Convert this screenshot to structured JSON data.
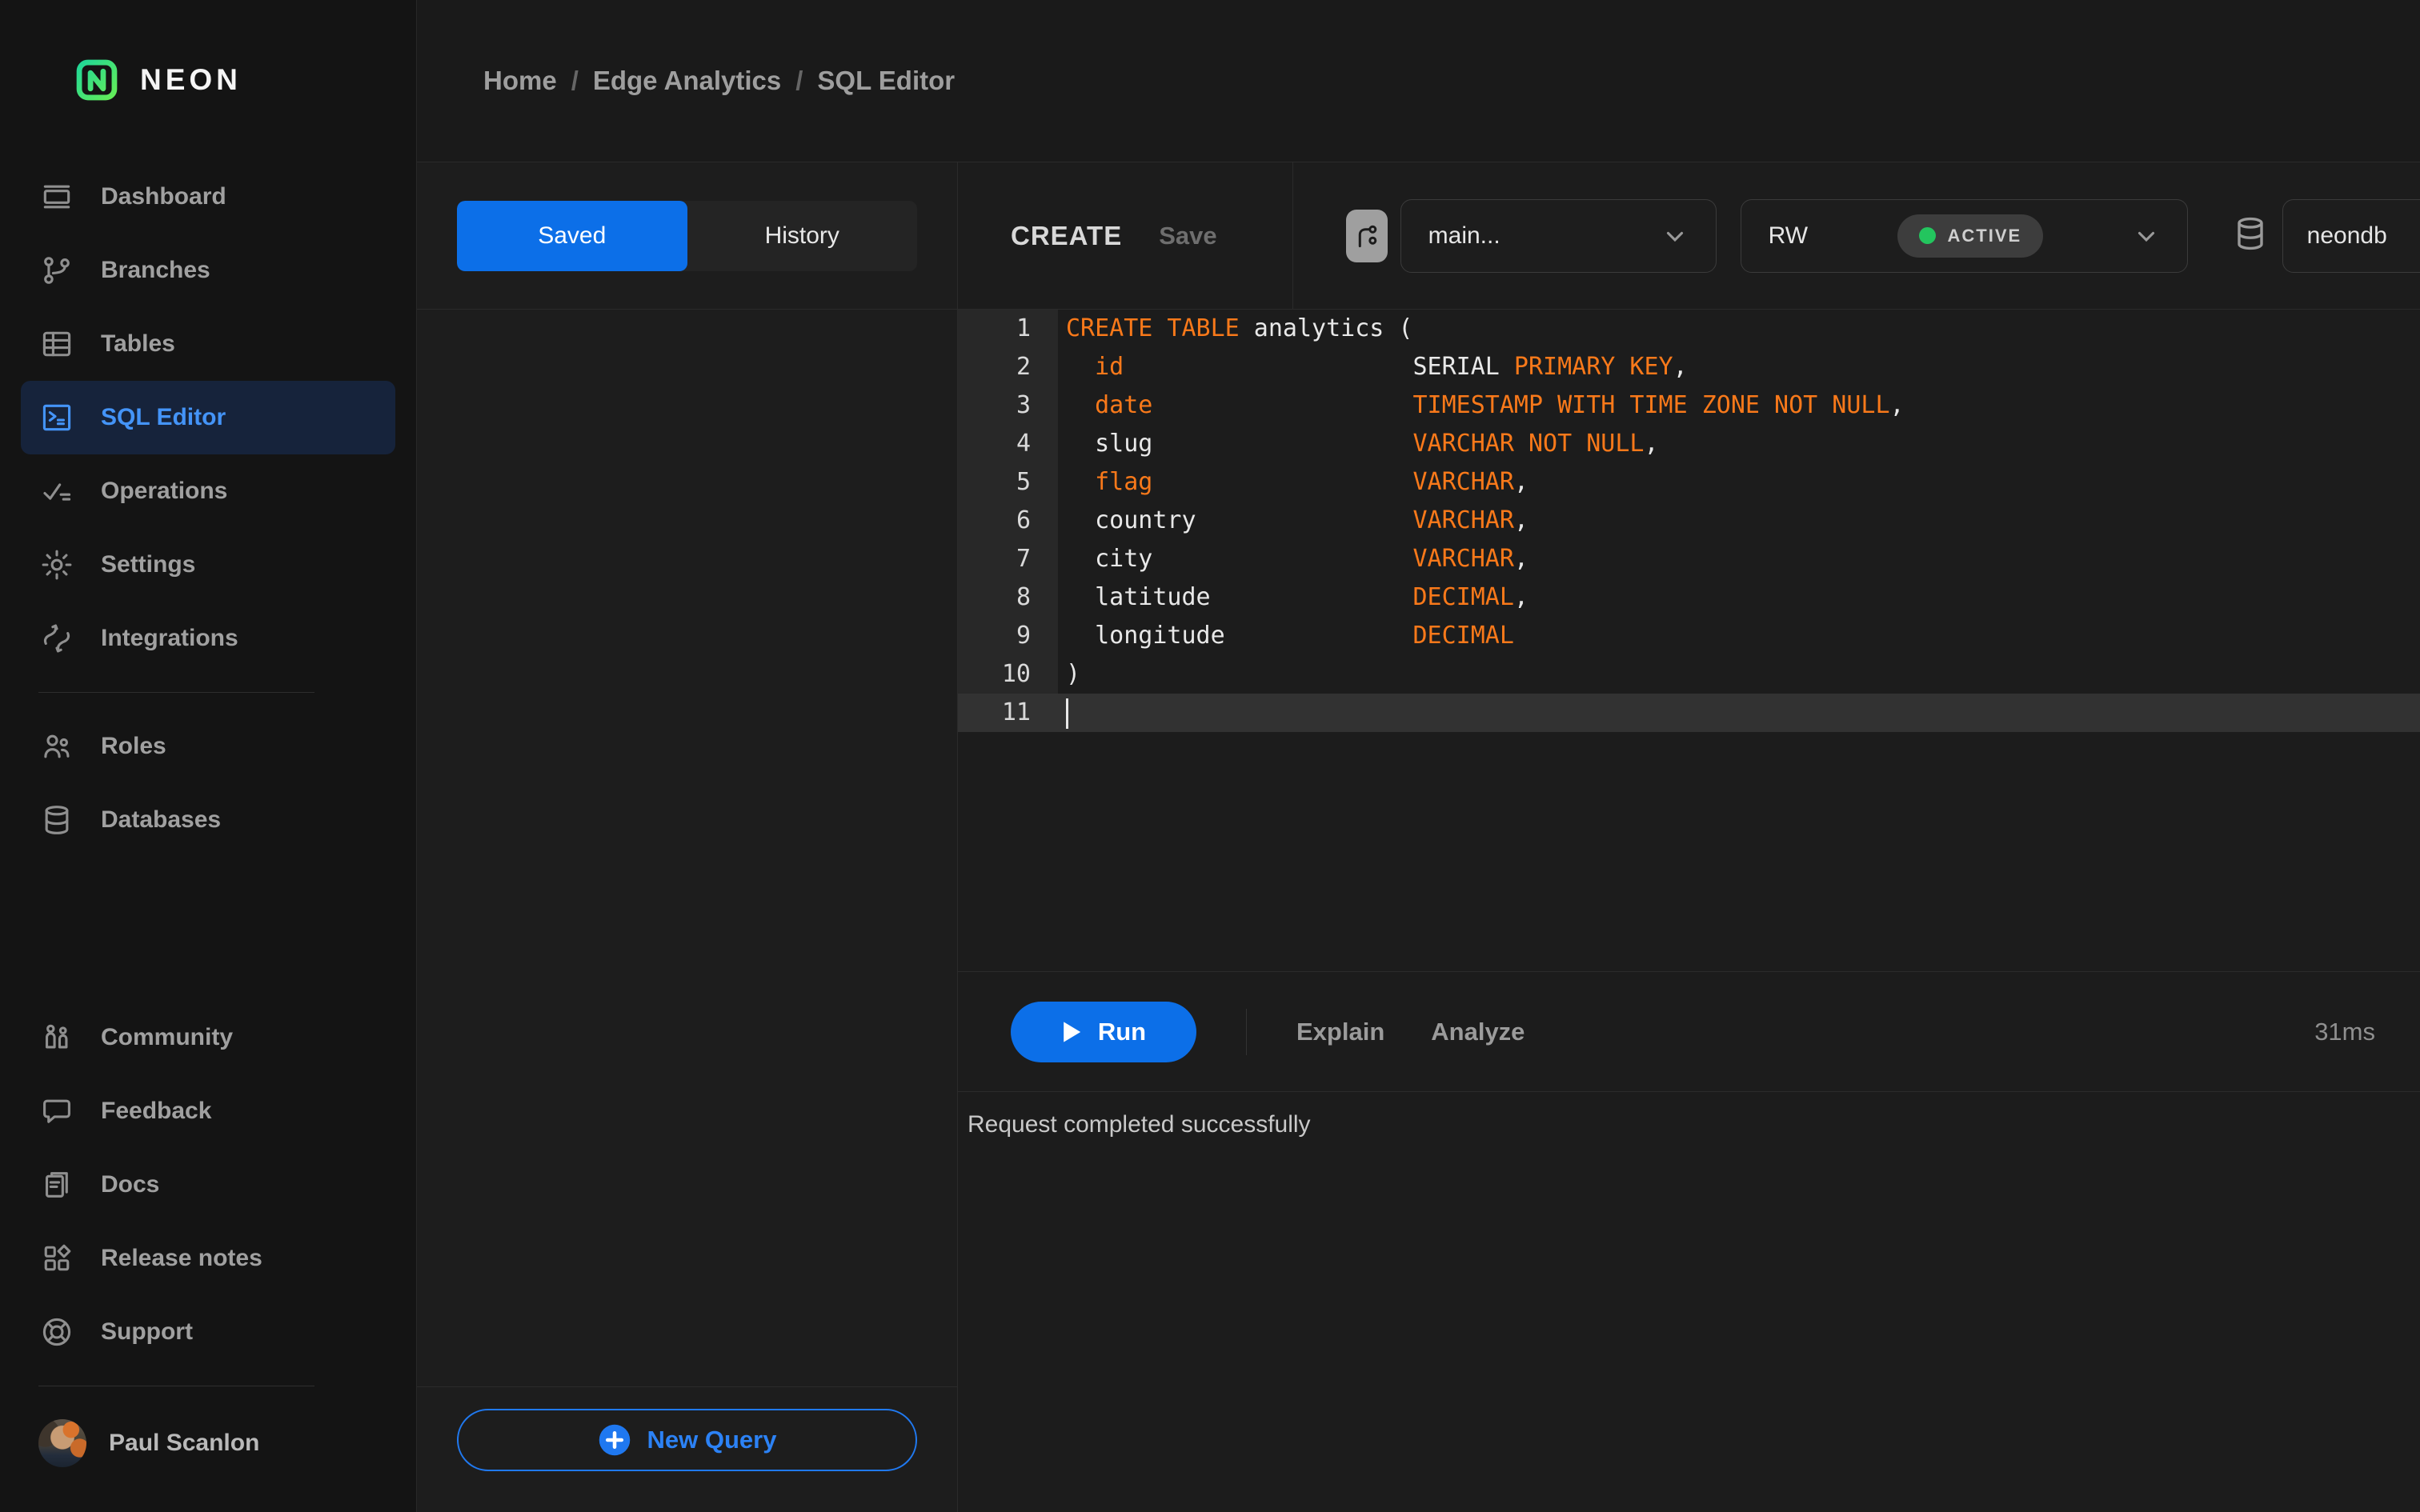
{
  "colors": {
    "accent_blue": "#0c6fe8",
    "outline_blue": "#2079f0",
    "active_nav_text": "#4494f8",
    "active_nav_bg": "#16233b",
    "keyword_orange": "#f9791a",
    "status_green": "#23c55e",
    "logo_gradient_start": "#16d4a1",
    "logo_gradient_end": "#6ef04e"
  },
  "sidebar": {
    "logo_text": "NEON",
    "groups": [
      [
        {
          "label": "Dashboard",
          "icon": "dashboard-icon"
        },
        {
          "label": "Branches",
          "icon": "branches-icon"
        },
        {
          "label": "Tables",
          "icon": "tables-icon"
        },
        {
          "label": "SQL Editor",
          "icon": "sql-editor-icon",
          "active": true
        },
        {
          "label": "Operations",
          "icon": "operations-icon"
        },
        {
          "label": "Settings",
          "icon": "settings-icon"
        },
        {
          "label": "Integrations",
          "icon": "integrations-icon"
        }
      ],
      [
        {
          "label": "Roles",
          "icon": "roles-icon"
        },
        {
          "label": "Databases",
          "icon": "databases-icon"
        }
      ],
      [
        {
          "label": "Community",
          "icon": "community-icon"
        },
        {
          "label": "Feedback",
          "icon": "feedback-icon"
        },
        {
          "label": "Docs",
          "icon": "docs-icon"
        },
        {
          "label": "Release notes",
          "icon": "release-notes-icon"
        },
        {
          "label": "Support",
          "icon": "support-icon"
        }
      ]
    ],
    "user": {
      "name": "Paul Scanlon"
    }
  },
  "breadcrumb": {
    "items": [
      "Home",
      "Edge Analytics",
      "SQL Editor"
    ],
    "separator": "/"
  },
  "left_panel": {
    "tabs": [
      {
        "label": "Saved",
        "active": true
      },
      {
        "label": "History",
        "active": false
      }
    ],
    "new_query_label": "New Query"
  },
  "editor": {
    "query_name": "CREATE",
    "save_label": "Save",
    "branch_select": {
      "value": "main..."
    },
    "compute_select": {
      "value": "RW",
      "status": "ACTIVE"
    },
    "database_select": {
      "value": "neondb"
    },
    "code_lines": [
      {
        "n": "1",
        "toks": [
          [
            "CREATE TABLE",
            "k"
          ],
          [
            " analytics (",
            "p"
          ]
        ]
      },
      {
        "n": "2",
        "toks": [
          [
            "  ",
            "p"
          ],
          [
            "id",
            "k"
          ],
          [
            "                    SERIAL ",
            "p"
          ],
          [
            "PRIMARY KEY",
            "k"
          ],
          [
            ",",
            "p"
          ]
        ]
      },
      {
        "n": "3",
        "toks": [
          [
            "  ",
            "p"
          ],
          [
            "date",
            "k"
          ],
          [
            "                  ",
            "p"
          ],
          [
            "TIMESTAMP WITH TIME ZONE NOT NULL",
            "k"
          ],
          [
            ",",
            "p"
          ]
        ]
      },
      {
        "n": "4",
        "toks": [
          [
            "  slug                  ",
            "p"
          ],
          [
            "VARCHAR NOT NULL",
            "k"
          ],
          [
            ",",
            "p"
          ]
        ]
      },
      {
        "n": "5",
        "toks": [
          [
            "  ",
            "p"
          ],
          [
            "flag",
            "k"
          ],
          [
            "                  ",
            "p"
          ],
          [
            "VARCHAR",
            "k"
          ],
          [
            ",",
            "p"
          ]
        ]
      },
      {
        "n": "6",
        "toks": [
          [
            "  country               ",
            "p"
          ],
          [
            "VARCHAR",
            "k"
          ],
          [
            ",",
            "p"
          ]
        ]
      },
      {
        "n": "7",
        "toks": [
          [
            "  city                  ",
            "p"
          ],
          [
            "VARCHAR",
            "k"
          ],
          [
            ",",
            "p"
          ]
        ]
      },
      {
        "n": "8",
        "toks": [
          [
            "  latitude              ",
            "p"
          ],
          [
            "DECIMAL",
            "k"
          ],
          [
            ",",
            "p"
          ]
        ]
      },
      {
        "n": "9",
        "toks": [
          [
            "  longitude             ",
            "p"
          ],
          [
            "DECIMAL",
            "k"
          ]
        ]
      },
      {
        "n": "10",
        "toks": [
          [
            ")",
            "p"
          ]
        ]
      },
      {
        "n": "11",
        "toks": [],
        "active": true,
        "cursor": true
      }
    ],
    "run_label": "Run",
    "explain_label": "Explain",
    "analyze_label": "Analyze",
    "duration": "31ms",
    "status_message": "Request completed successfully"
  }
}
